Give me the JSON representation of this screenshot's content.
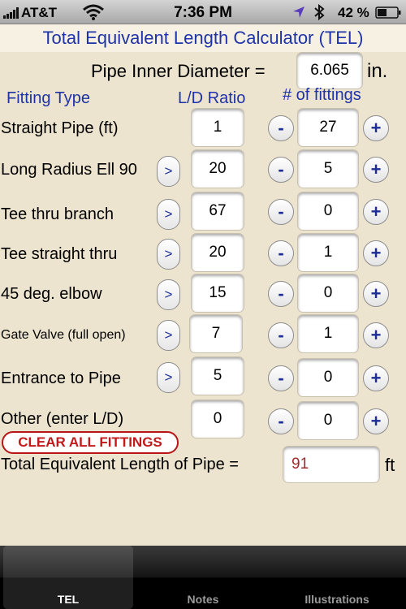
{
  "status_bar": {
    "carrier": "AT&T",
    "time": "7:36 PM",
    "battery_percent": "42 %"
  },
  "title": "Total Equivalent Length Calculator (TEL)",
  "pipe_diameter": {
    "label": "Pipe Inner Diameter =",
    "value": "6.065",
    "unit": "in."
  },
  "headers": {
    "fitting_type": "Fitting Type",
    "ld_ratio": "L/D Ratio",
    "num_fittings": "# of fittings"
  },
  "rows": [
    {
      "label": "Straight Pipe (ft)",
      "ld": "1",
      "count": "27"
    },
    {
      "label": "Long Radius Ell 90",
      "ld": "20",
      "count": "5"
    },
    {
      "label": "Tee thru branch",
      "ld": "67",
      "count": "0"
    },
    {
      "label": "Tee straight thru",
      "ld": "20",
      "count": "1"
    },
    {
      "label": "45 deg. elbow",
      "ld": "15",
      "count": "0"
    },
    {
      "label": "Gate Valve (full open)",
      "ld": "7",
      "count": "1"
    },
    {
      "label": "Entrance to Pipe",
      "ld": "5",
      "count": "0"
    },
    {
      "label": "Other (enter L/D)",
      "ld": "0",
      "count": "0"
    }
  ],
  "buttons": {
    "select": ">",
    "minus": "-",
    "plus": "+",
    "clear": "CLEAR ALL FITTINGS"
  },
  "total": {
    "label": "Total Equivalent Length of Pipe =",
    "value": "91",
    "unit": "ft"
  },
  "tabs": [
    {
      "label": "TEL",
      "selected": true
    },
    {
      "label": "Notes",
      "selected": false
    },
    {
      "label": "Illustrations",
      "selected": false
    }
  ],
  "colors": {
    "background": "#ede4cf",
    "title_text": "#1f33a8",
    "clear_button": "#c21a1a",
    "total_value": "#a02a2a"
  }
}
